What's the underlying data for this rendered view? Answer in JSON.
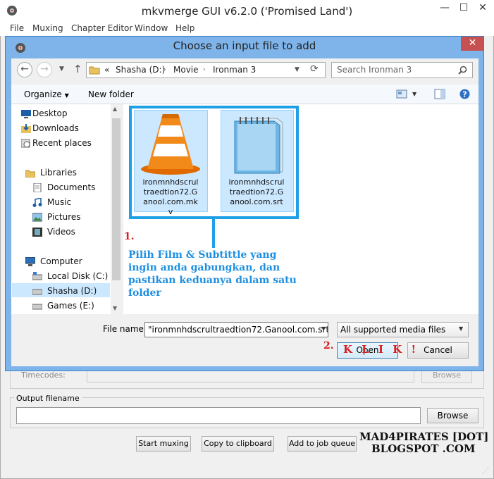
{
  "main_window": {
    "title": "mkvmerge GUI v6.2.0 ('Promised Land')",
    "controls": {
      "minimize": "—",
      "maximize": "☐",
      "close": "✕"
    },
    "menu": [
      "File",
      "Muxing",
      "Chapter Editor",
      "Window",
      "Help"
    ],
    "timecodes_label": "Timecodes:",
    "timecodes_browse": "Browse",
    "output_filename_label": "Output filename",
    "output_browse": "Browse",
    "buttons": {
      "start_muxing": "Start muxing",
      "copy_clipboard": "Copy to clipboard",
      "add_job_queue": "Add to job queue"
    }
  },
  "dialog": {
    "title": "Choose an input file to add",
    "close": "✕",
    "breadcrumb": [
      "«",
      "Shasha (D:)",
      "Movie",
      "Ironman 3"
    ],
    "search_placeholder": "Search Ironman 3",
    "toolbar": {
      "organize": "Organize",
      "new_folder": "New folder"
    },
    "nav_items": [
      {
        "label": "Desktop",
        "icon": "desktop-icon"
      },
      {
        "label": "Downloads",
        "icon": "downloads-icon"
      },
      {
        "label": "Recent places",
        "icon": "recent-places-icon"
      },
      {
        "label": "Libraries",
        "icon": "libraries-icon"
      },
      {
        "label": "Documents",
        "icon": "documents-icon"
      },
      {
        "label": "Music",
        "icon": "music-icon"
      },
      {
        "label": "Pictures",
        "icon": "pictures-icon"
      },
      {
        "label": "Videos",
        "icon": "videos-icon"
      },
      {
        "label": "Computer",
        "icon": "computer-icon"
      },
      {
        "label": "Local Disk (C:)",
        "icon": "drive-icon"
      },
      {
        "label": "Shasha (D:)",
        "icon": "drive-icon"
      },
      {
        "label": "Games (E:)",
        "icon": "drive-icon"
      }
    ],
    "files": [
      {
        "name": "ironmnhdscrultraedtion72.Ganool.com.mkv",
        "icon": "vlc-cone-icon"
      },
      {
        "name": "ironmnhdscrultraedtion72.Ganool.com.srt",
        "icon": "notepad-icon"
      }
    ],
    "file_name_label": "File name:",
    "file_name_value": "\"ironmnhdscrultraedtion72.Ganool.com.srt\" \"",
    "file_type": "All supported media files",
    "open_button": "Open",
    "cancel_button": "Cancel"
  },
  "annotations": {
    "step1": "1.",
    "step1_text": "Pilih Film & Subtittle yang ingin anda gabungkan, dan pastikan keduanya dalam satu folder",
    "step2": "2.",
    "klik": "K L I K !",
    "watermark_line1": "MAD4PIRATES [DOT]",
    "watermark_line2": "BLOGSPOT .COM"
  },
  "colors": {
    "dialog_frame": "#7eb4ea",
    "tile_selected": "#cce8ff",
    "highlight_box": "#1ea0e6",
    "annotation_red": "#d81e1e",
    "annotation_blue": "#1e8fe0"
  }
}
